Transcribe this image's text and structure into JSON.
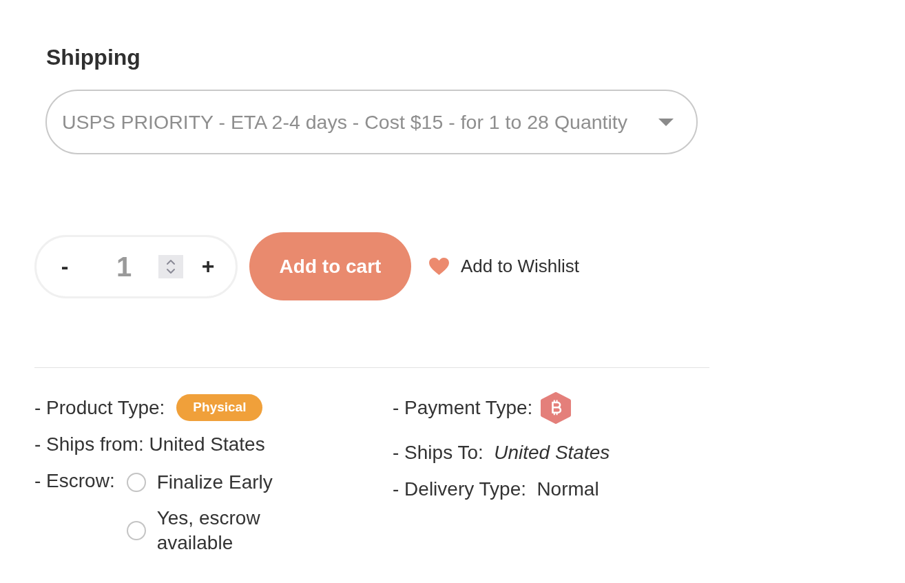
{
  "shipping": {
    "title": "Shipping",
    "value": "USPS PRIORITY - ETA 2-4 days - Cost $15 - for 1 to 28 Quantity"
  },
  "quantity": {
    "decrement_label": "-",
    "value": "1",
    "increment_label": "+"
  },
  "add_to_cart_button": "Add to cart",
  "wishlist_link": "Add to Wishlist",
  "details": {
    "left": [
      {
        "kind": "badge",
        "label": "- Product Type:",
        "value": "Physical"
      },
      {
        "kind": "text",
        "label": "- Ships from:",
        "value": "United States",
        "italic": false
      },
      {
        "kind": "radios",
        "label": "- Escrow:",
        "options": [
          {
            "label": "Finalize Early",
            "selected": false
          },
          {
            "label": "Yes, escrow available",
            "selected": false
          }
        ]
      }
    ],
    "right": [
      {
        "kind": "coin",
        "label": "- Payment Type:"
      },
      {
        "kind": "text",
        "label": "- Ships To:",
        "value": "United States",
        "italic": true
      },
      {
        "kind": "text",
        "label": "- Delivery Type:",
        "value": "Normal",
        "italic": false
      }
    ]
  }
}
